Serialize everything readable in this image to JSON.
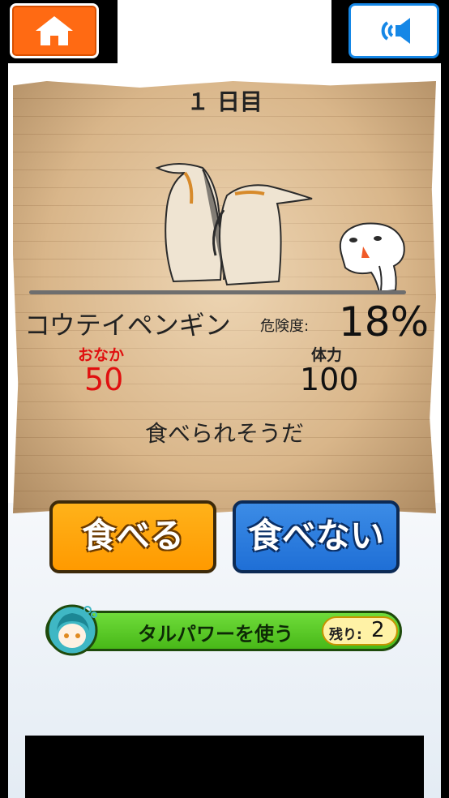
{
  "header": {
    "home_icon": "home-icon",
    "sound_icon": "speaker-icon"
  },
  "colors": {
    "home_button": "#ff6a13",
    "sound_button_border": "#1587e6",
    "eat_button": "#ff9a00",
    "no_eat_button": "#1f6fd6",
    "power_bar": "#48b818",
    "hunger_text": "#e01010"
  },
  "status": {
    "day": "１ 日目",
    "animal_name": "コウテイペンギン",
    "danger_label": "危険度:",
    "danger_value": "18%",
    "hunger_label": "おなか",
    "hunger_value": "50",
    "hp_label": "体力",
    "hp_value": "100",
    "comment": "食べられそうだ"
  },
  "actions": {
    "eat_label": "食べる",
    "no_eat_label": "食べない"
  },
  "power": {
    "label": "タルパワーを使う",
    "remain_label": "残り:",
    "remain_value": "2"
  }
}
